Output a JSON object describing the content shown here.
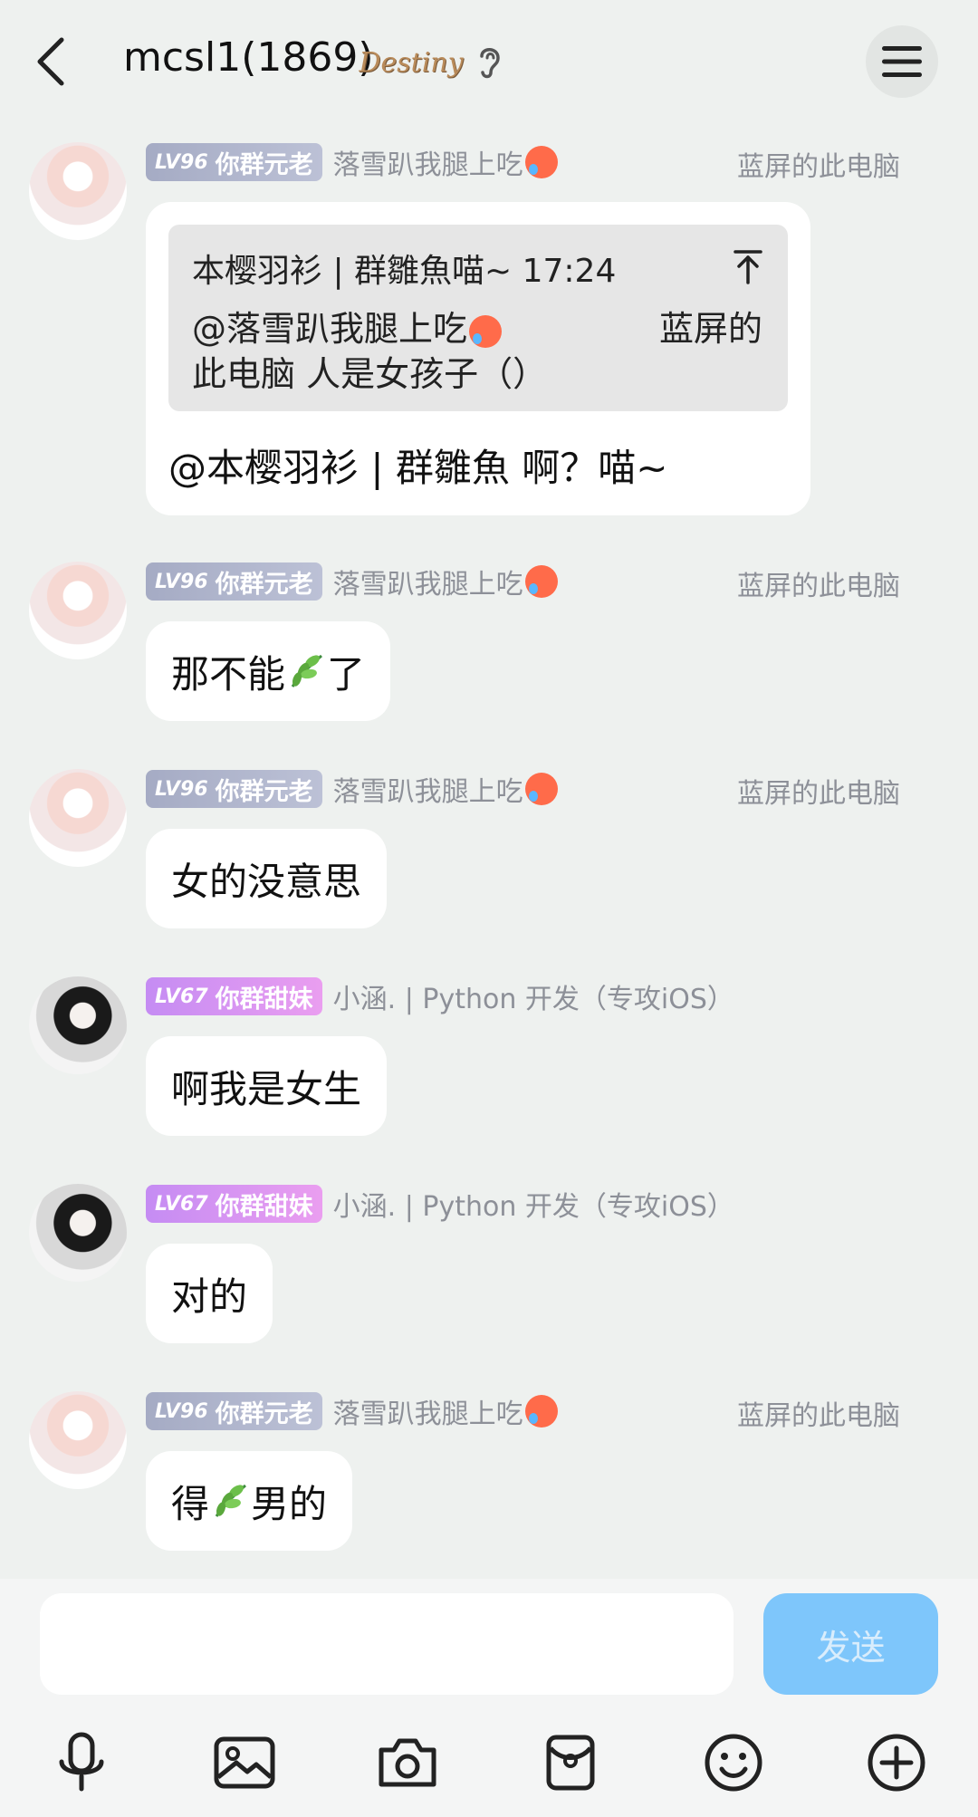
{
  "header": {
    "title": "mcsl1(1869)",
    "badge_text": "Destiny",
    "menu_icon": "hamburger-icon",
    "back_icon": "chevron-left-icon",
    "ear_icon": "ear-icon"
  },
  "reply": {
    "level": "LV96",
    "rank": "你群元老",
    "sender": "落雪趴我腿上吃",
    "group_title": "蓝屏的此电脑",
    "quote": {
      "author_time": "本樱羽衫 | 群雛魚喵~ 17:24",
      "line1": "@落雪趴我腿上吃",
      "line1_right": "蓝屏的",
      "line2": "此电脑 人是女孩子（）"
    },
    "text": "@本樱羽衫 | 群雛魚 啊？喵~"
  },
  "messages": [
    {
      "level": "LV96",
      "rank": "你群元老",
      "sender": "落雪趴我腿上吃",
      "group_title": "蓝屏的此电脑",
      "text_before": "那不能",
      "text_after": "了"
    },
    {
      "level": "LV96",
      "rank": "你群元老",
      "sender": "落雪趴我腿上吃",
      "group_title": "蓝屏的此电脑",
      "text": "女的没意思"
    },
    {
      "level": "LV67",
      "rank": "你群甜妹",
      "sender": "小涵. | Python 开发（专攻iOS）",
      "text": "啊我是女生"
    },
    {
      "level": "LV67",
      "rank": "你群甜妹",
      "sender": "小涵. | Python 开发（专攻iOS）",
      "text": "对的"
    },
    {
      "level": "LV96",
      "rank": "你群元老",
      "sender": "落雪趴我腿上吃",
      "group_title": "蓝屏的此电脑",
      "text_before": "得",
      "text_after": "男的"
    }
  ],
  "input": {
    "value": "",
    "placeholder": "",
    "send_label": "发送"
  },
  "toolbar": [
    "microphone-icon",
    "image-icon",
    "camera-icon",
    "red-packet-icon",
    "emoji-icon",
    "plus-icon"
  ],
  "colors": {
    "background": "#eef1ef",
    "send_button": "#7ec6fb",
    "tag_grey": "#a5abc4",
    "tag_pink": "#c58cf3"
  }
}
